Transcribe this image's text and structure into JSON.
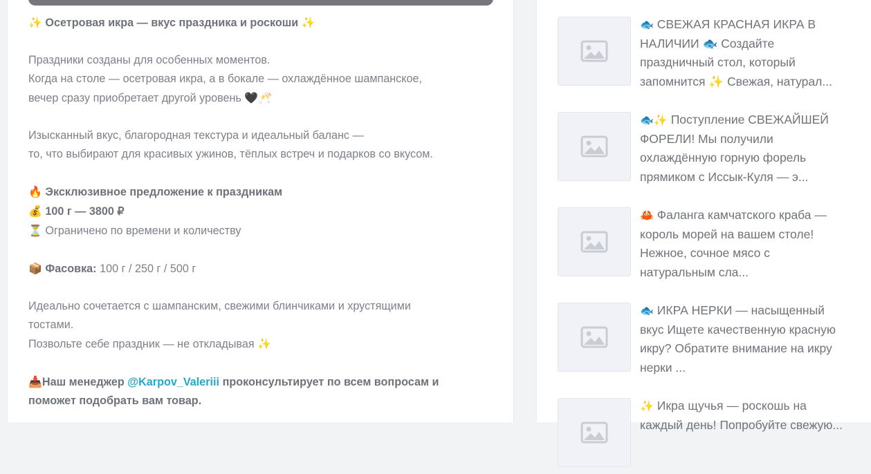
{
  "post": {
    "title": "Осетровая икра — вкус праздника и роскоши",
    "para1_line1": "Праздники созданы для особенных моментов.",
    "para1_line2": "Когда на столе — осетровая икра, а в бокале — охлаждённое шампанское,",
    "para1_line3": "вечер сразу приобретает другой уровень",
    "para2_line1": "Изысканный вкус, благородная текстура и идеальный баланс —",
    "para2_line2": "то, что выбирают для красивых ужинов, тёплых встреч и подарков со вкусом.",
    "offer_title": "Эксклюзивное предложение к праздникам",
    "price": "100 г — 3800 ₽",
    "limited": "Ограничено по времени и количеству",
    "packing_label": "Фасовка:",
    "packing_value": "100 г / 250 г / 500 г",
    "para4_line1": "Идеально сочетается с шампанским, свежими блинчиками и хрустящими",
    "para4_line2": "тостами.",
    "para4_line3": "Позвольте себе праздник — не откладывая",
    "manager_prefix": "Наш менеджер",
    "manager_link": "@Karpov_Valeriii",
    "manager_suffix": "проконсультирует по всем вопросам и",
    "manager_line2": "поможет подобрать вам товар."
  },
  "related": [
    {
      "emoji": "🐟",
      "text": "СВЕЖАЯ КРАСНАЯ ИКРА В НАЛИЧИИ 🐟 Создайте праздничный стол, который запомнится ✨ Свежая, натурал..."
    },
    {
      "emoji": "🐟✨",
      "text": "Поступление СВЕЖАЙШЕЙ ФОРЕЛИ! Мы получили охлаждённую горную форель прямиком с Иссык-Куля — э..."
    },
    {
      "emoji": "🦀",
      "text": "Фаланга камчатского краба — король морей на вашем столе! Нежное, сочное мясо с натуральным сла..."
    },
    {
      "emoji": "🐟",
      "text": "ИКРА НЕРКИ — насыщенный вкус Ищете качественную красную икру? Обратите внимание на икру нерки ..."
    },
    {
      "emoji": "✨",
      "text": "Икра щучья — роскошь на каждый день! Попробуйте свежую..."
    }
  ]
}
